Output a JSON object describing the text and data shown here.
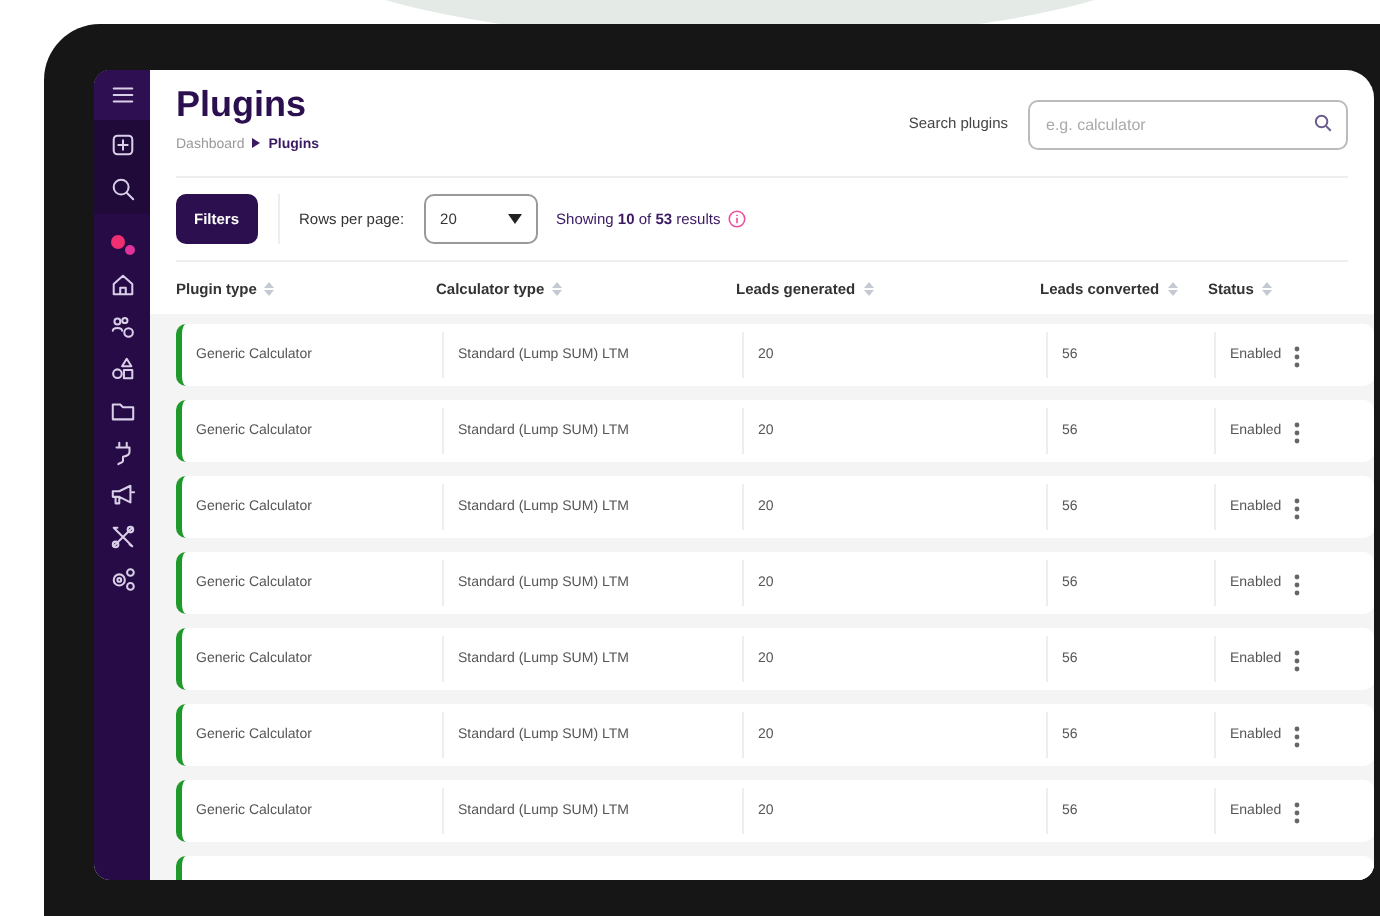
{
  "page": {
    "title": "Plugins",
    "breadcrumb": [
      {
        "label": "Dashboard",
        "selected": false
      },
      {
        "label": "Plugins",
        "selected": true
      }
    ]
  },
  "search": {
    "label": "Search plugins",
    "placeholder": "e.g. calculator"
  },
  "toolbar": {
    "filters_button": "Filters",
    "rows_label": "Rows per page:",
    "rows_value": "20",
    "summary": "Showing **10** of **53** results"
  },
  "table": {
    "columns": [
      "Plugin type",
      "Calculator type",
      "Leads generated",
      "Leads converted",
      "Status"
    ],
    "rows": [
      {
        "plugin_type": "Generic Calculator",
        "calculator_type": "Standard (Lump SUM) LTM",
        "leads_generated": "20",
        "leads_converted": "56",
        "status": "Enabled"
      },
      {
        "plugin_type": "Generic Calculator",
        "calculator_type": "Standard (Lump SUM) LTM",
        "leads_generated": "20",
        "leads_converted": "56",
        "status": "Enabled"
      },
      {
        "plugin_type": "Generic Calculator",
        "calculator_type": "Standard (Lump SUM) LTM",
        "leads_generated": "20",
        "leads_converted": "56",
        "status": "Enabled"
      },
      {
        "plugin_type": "Generic Calculator",
        "calculator_type": "Standard (Lump SUM) LTM",
        "leads_generated": "20",
        "leads_converted": "56",
        "status": "Enabled"
      },
      {
        "plugin_type": "Generic Calculator",
        "calculator_type": "Standard (Lump SUM) LTM",
        "leads_generated": "20",
        "leads_converted": "56",
        "status": "Enabled"
      },
      {
        "plugin_type": "Generic Calculator",
        "calculator_type": "Standard (Lump SUM) LTM",
        "leads_generated": "20",
        "leads_converted": "56",
        "status": "Enabled"
      },
      {
        "plugin_type": "Generic Calculator",
        "calculator_type": "Standard (Lump SUM) LTM",
        "leads_generated": "20",
        "leads_converted": "56",
        "status": "Enabled"
      }
    ]
  }
}
